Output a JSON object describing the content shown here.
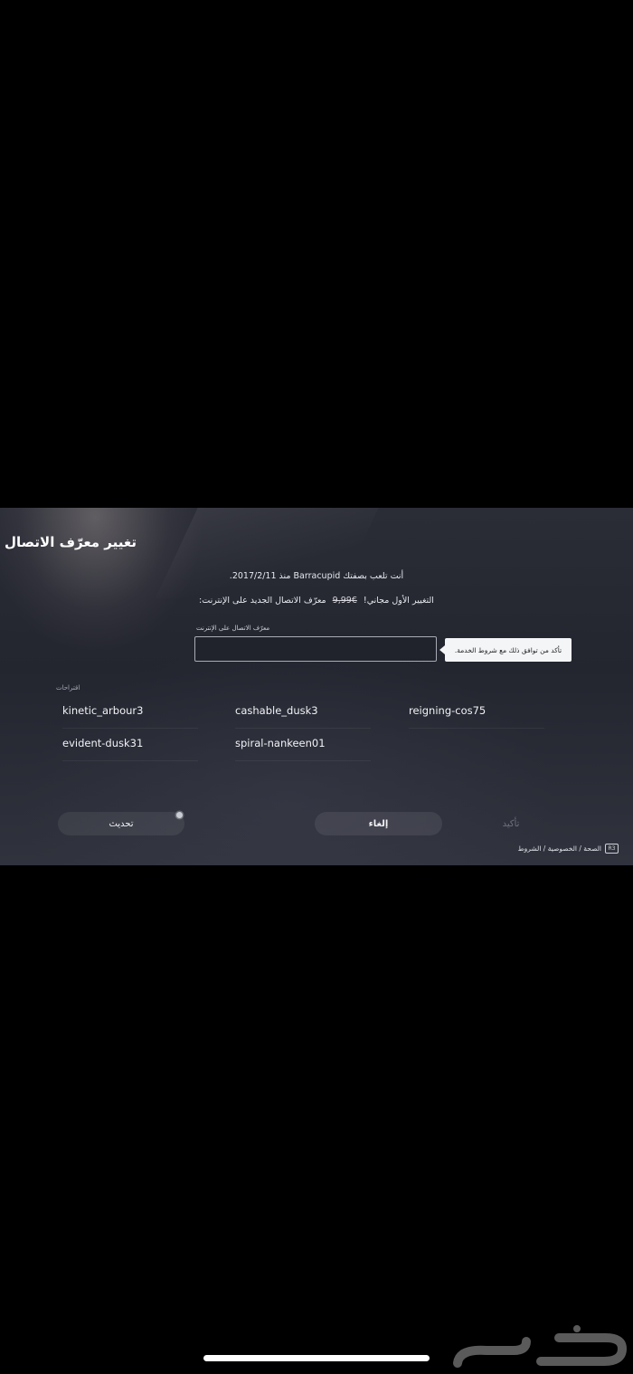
{
  "dialog": {
    "title": "تغيير معرّف الاتصال",
    "line1": "أنت تلعب بصفتك Barracupid منذ 2017/2/11.",
    "line2_prefix": "التغيير الأول مجاني!",
    "line2_price": "€9,99",
    "line2_suffix": "معرّف الاتصال الجديد على الإنترنت:",
    "field_label": "معرّف الاتصال على الإنترنت",
    "field_value": "",
    "tooltip": "تأكد من توافق ذلك مع شروط الخدمة."
  },
  "suggestions": {
    "label": "اقتراحات",
    "items": [
      "kinetic_arbour3",
      "cashable_dusk3",
      "reigning-cos75",
      "evident-dusk31",
      "spiral-nankeen01"
    ]
  },
  "buttons": {
    "refresh": "تحديث",
    "cancel": "إلغاء",
    "confirm": "تأكيد"
  },
  "footer": {
    "badge": "R3",
    "text": "الصحة / الخصوصية / الشروط"
  },
  "watermark": {
    "text": "حراج"
  },
  "colors": {
    "background": "#000000",
    "panel": "#2a2c36",
    "tooltip_bg": "#f4f5f7"
  }
}
